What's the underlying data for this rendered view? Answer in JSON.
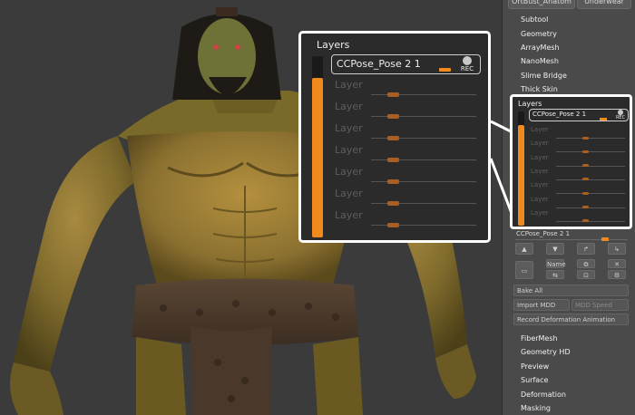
{
  "top_tabs": [
    {
      "label": "OrtBust_Anatom"
    },
    {
      "label": "Underwear"
    }
  ],
  "menu_top": [
    {
      "label": "Subtool"
    },
    {
      "label": "Geometry"
    },
    {
      "label": "ArrayMesh"
    },
    {
      "label": "NanoMesh"
    },
    {
      "label": "Slime Bridge"
    },
    {
      "label": "Thick Skin"
    }
  ],
  "layers_panel": {
    "title": "Layers",
    "active_layer": "CCPose_Pose 2 1",
    "rec_label": "REC",
    "layer_label": "Layer",
    "layer_count": 7
  },
  "lower_panel": {
    "layer_name": "CCPose_Pose 2 1",
    "icon_labels": {
      "name": "Name"
    },
    "bake_all": "Bake All",
    "import_mdd": "Import MDD",
    "mdd_speed": "MDD Speed",
    "record_deformation": "Record Deformation Animation"
  },
  "menu_bottom": [
    {
      "label": "FiberMesh"
    },
    {
      "label": "Geometry HD"
    },
    {
      "label": "Preview"
    },
    {
      "label": "Surface"
    },
    {
      "label": "Deformation"
    },
    {
      "label": "Masking"
    }
  ],
  "colors": {
    "accent": "#f08a1c",
    "panel_bg": "#2b2b2b",
    "sidebar_bg": "#4a4a4a",
    "highlight_border": "#ffffff"
  }
}
